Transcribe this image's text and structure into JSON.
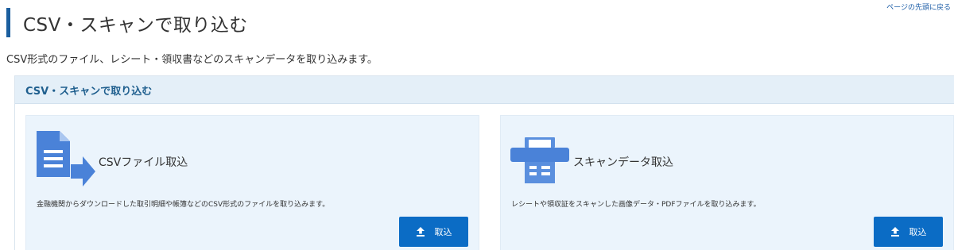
{
  "nav": {
    "back_to_top": "ページの先頭に戻る"
  },
  "header": {
    "title": "CSV・スキャンで取り込む"
  },
  "description": "CSV形式のファイル、レシート・領収書などのスキャンデータを取り込みます。",
  "panel": {
    "title": "CSV・スキャンで取り込む",
    "cards": [
      {
        "title": "CSVファイル取込",
        "description": "金融機関からダウンロードした取引明細や帳簿などのCSV形式のファイルを取り込みます。",
        "button_label": "取込",
        "icon": "csv-file-import-icon"
      },
      {
        "title": "スキャンデータ取込",
        "description": "レシートや領収証をスキャンした画像データ・PDFファイルを取り込みます。",
        "button_label": "取込",
        "icon": "scanner-icon"
      }
    ]
  },
  "colors": {
    "accent": "#0b6cc5",
    "header_bar": "#1a5e9e",
    "panel_header_bg": "#e4eff8",
    "card_bg": "#ebf4fc",
    "icon_blue": "#4a82d8"
  }
}
